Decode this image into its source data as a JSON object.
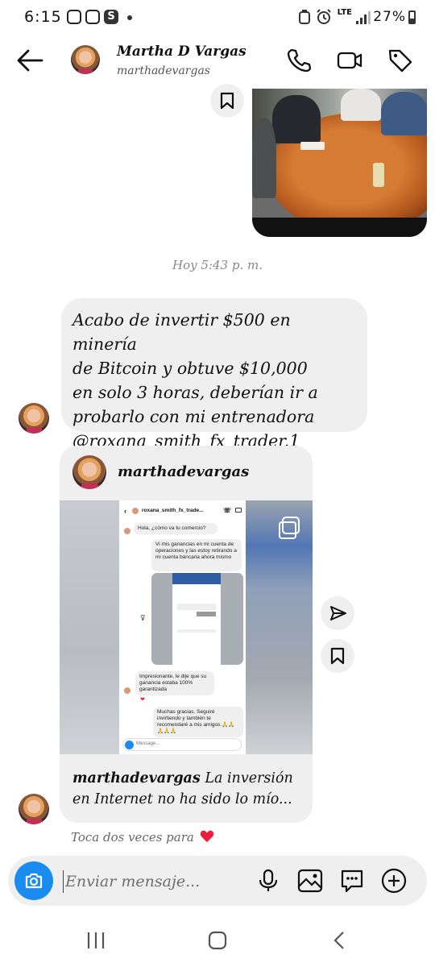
{
  "status_bar": {
    "time": "6:15",
    "network": "LTE",
    "battery": "27%",
    "icons": [
      "instagram-icon",
      "instagram-icon",
      "s-app-icon",
      "notification-dot",
      "alarm-icon",
      "signal-icon",
      "battery-icon"
    ]
  },
  "header": {
    "name": "Martha D Vargas",
    "username": "marthadevargas",
    "icons": [
      "back-arrow-icon",
      "phone-icon",
      "video-camera-icon",
      "tag-icon"
    ]
  },
  "chat": {
    "timestamp": "Hoy 5:43 p. m.",
    "message_1": {
      "lines": [
        "Acabo de invertir $500 en minería",
        "de Bitcoin y obtuve $10,000",
        "en solo 3 horas, deberían ir a",
        "probarlo con mi entrenadora",
        "@roxana_smith_fx_trader.1"
      ]
    },
    "shared_post": {
      "username": "marthadevargas",
      "caption_user": "marthadevargas",
      "caption_text": "La inversión en Internet no ha sido lo mío...",
      "screenshot": {
        "account": "roxana_smith_fx_trade...",
        "messages": [
          "Hola, ¿cómo va tu comercio?",
          "Vi mis ganancias en mi cuenta de operaciones y las estoy retirando a mi cuenta bancaria ahora mismo",
          "Impresionante, le dije que su ganancia estaba 100% garantizada",
          "Muchas gracias. Seguiré invirtiendo y también te recomendaré a mis amigos.🙏🙏🙏🙏🙏"
        ],
        "input_placeholder": "Message..."
      }
    },
    "hint": "Toca dos veces para"
  },
  "composer": {
    "placeholder": "Enviar mensaje...",
    "icons": [
      "camera-icon",
      "microphone-icon",
      "gallery-icon",
      "sticker-icon",
      "add-icon"
    ]
  },
  "navigation": [
    "recent-apps-icon",
    "home-icon",
    "back-icon"
  ],
  "colors": {
    "bubble": "#efefef",
    "accent_blue": "#1a8cf0",
    "heart": "#ed1c3a"
  }
}
